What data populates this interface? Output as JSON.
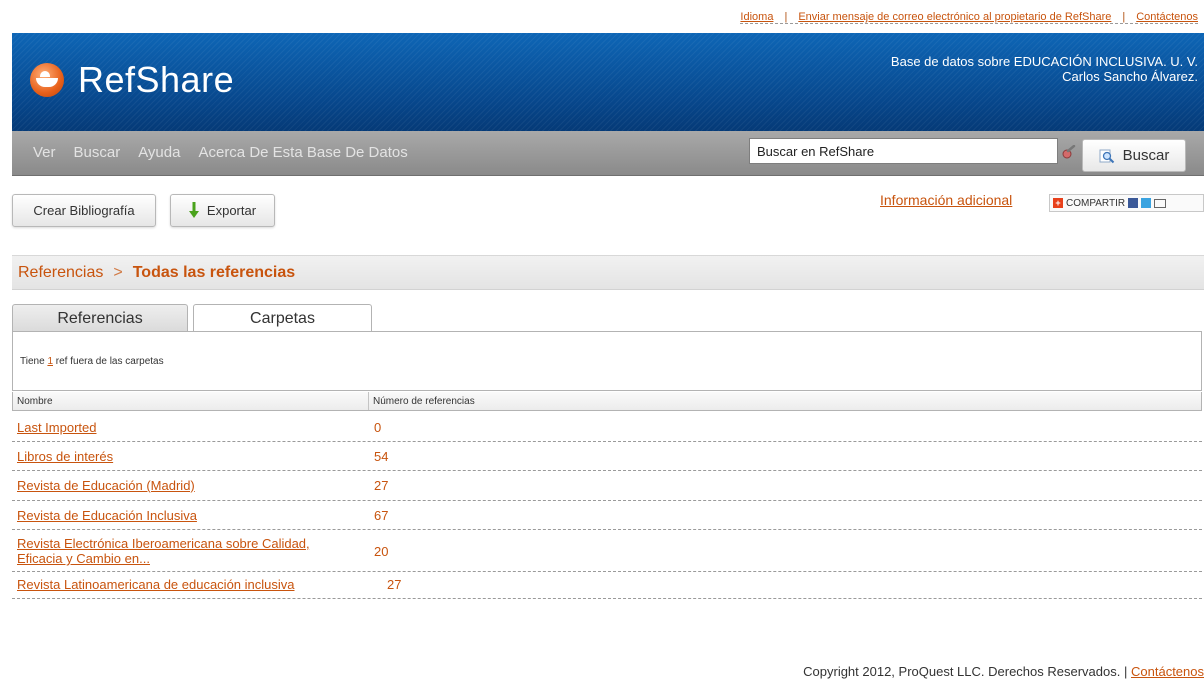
{
  "toplinks": {
    "idioma": "Idioma",
    "email_owner": "Enviar mensaje de correo electrónico al propietario de RefShare",
    "contact": "Contáctenos"
  },
  "header": {
    "logo": "RefShare",
    "database_line": "Base de datos sobre EDUCACIÓN INCLUSIVA. U. V.",
    "owner_line": "Carlos Sancho Álvarez."
  },
  "nav": {
    "items": [
      {
        "label": "Ver"
      },
      {
        "label": "Buscar"
      },
      {
        "label": "Ayuda"
      },
      {
        "label": "Acerca De Esta Base De Datos"
      }
    ],
    "search_placeholder": "Buscar en RefShare",
    "search_button": "Buscar"
  },
  "toolbar": {
    "crear_label": "Crear Bibliografía",
    "exportar_label": "Exportar",
    "info_link": "Información adicional",
    "share_label": "COMPARTIR"
  },
  "breadcrumb": {
    "root": "Referencias",
    "separator": ">",
    "current": "Todas las referencias"
  },
  "tabs": [
    {
      "label": "Referencias"
    },
    {
      "label": "Carpetas"
    }
  ],
  "panel": {
    "prefix": "Tiene",
    "count": "1",
    "suffix": "ref fuera de las carpetas"
  },
  "table": {
    "headers": {
      "name": "Nombre",
      "count": "Número de referencias"
    },
    "rows": [
      {
        "name": "Last Imported",
        "count": "0"
      },
      {
        "name": "Libros de interés",
        "count": "54"
      },
      {
        "name": "Revista de Educación (Madrid)",
        "count": "27"
      },
      {
        "name": "Revista de Educación Inclusiva",
        "count": "67"
      },
      {
        "name": "Revista Electrónica Iberoamericana sobre Calidad, Eficacia y Cambio en...",
        "count": "20"
      },
      {
        "name": "Revista Latinoamericana de educación inclusiva",
        "count": "27"
      }
    ]
  },
  "footer": {
    "copyright": "Copyright 2012, ProQuest LLC. Derechos Reservados.",
    "separator": "|",
    "contact": "Contáctenos"
  },
  "colors": {
    "accent": "#c8540e",
    "banner": "#07478c",
    "nav": "#999999"
  }
}
